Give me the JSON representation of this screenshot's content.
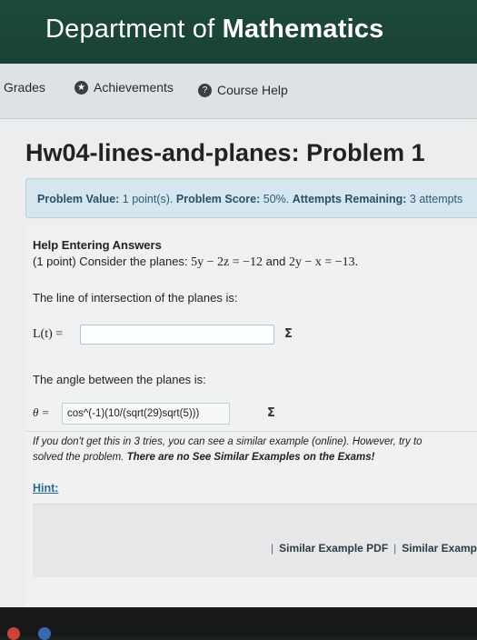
{
  "header": {
    "title_plain": "Department of ",
    "title_bold": "Mathematics"
  },
  "nav": {
    "grades": "Grades",
    "achievements": "Achievements",
    "course_help": "Course Help"
  },
  "problem": {
    "title": "Hw04-lines-and-planes: Problem 1",
    "value_label": "Problem Value:",
    "value": "1 point(s).",
    "score_label": "Problem Score:",
    "score": "50%.",
    "attempts_label": "Attempts Remaining:",
    "attempts": "3 attempts"
  },
  "body": {
    "help_title": "Help Entering Answers",
    "statement_prefix": "(1 point) Consider the planes: ",
    "plane1": "5y − 2z = −12",
    "and": " and ",
    "plane2": "2y − x = −13.",
    "line_prompt": "The line of intersection of the planes is:",
    "line_label": "L(t) =",
    "line_value": "",
    "angle_prompt": "The angle between the planes is:",
    "theta_label": "θ =",
    "theta_value": "cos^(-1)(10/(sqrt(29)sqrt(5)))",
    "note_part1": "If you don't get this in 3 tries, you can see a similar example (online). However, try to",
    "note_part2": "solved the problem. ",
    "note_bold": "There are no See Similar Examples on the Exams!",
    "hint_label": "Hint:",
    "similar_pdf": "Similar Example PDF",
    "similar_online": "Similar Example"
  },
  "icons": {
    "sigma": "Σ",
    "star": "★",
    "question": "?"
  },
  "colors": {
    "header_bg": "#1d4a3a",
    "info_bg": "#d5e6ee",
    "link": "#2b6a90"
  }
}
